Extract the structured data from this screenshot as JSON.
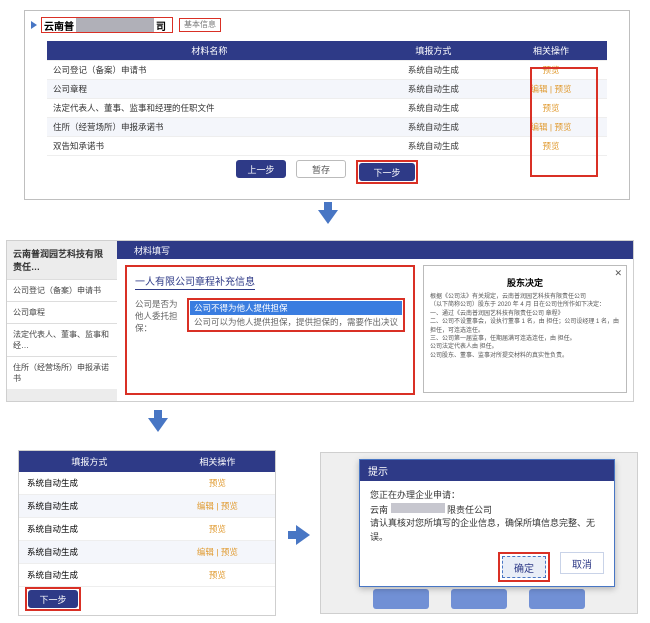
{
  "panel1": {
    "title_prefix": "云南普",
    "title_suffix": "司",
    "breadcrumb": "基本信息",
    "columns": {
      "name": "材料名称",
      "gen": "填报方式",
      "act": "相关操作"
    },
    "rows": [
      {
        "name": "公司登记（备案）申请书",
        "gen": "系统自动生成",
        "act": "预览"
      },
      {
        "name": "公司章程",
        "gen": "系统自动生成",
        "act": "编辑 | 预览"
      },
      {
        "name": "法定代表人、董事、监事和经理的任职文件",
        "gen": "系统自动生成",
        "act": "预览"
      },
      {
        "name": "住所（经营场所）申报承诺书",
        "gen": "系统自动生成",
        "act": "编辑 | 预览"
      },
      {
        "name": "双告知承诺书",
        "gen": "系统自动生成",
        "act": "预览"
      }
    ],
    "buttons": {
      "prev": "上一步",
      "save": "暂存",
      "next": "下一步"
    }
  },
  "panel2": {
    "side_title": "云南普润园艺科技有限责任…",
    "side_items": [
      "公司登记（备案）申请书",
      "公司章程",
      "法定代表人、董事、监事和经…",
      "住所（经营场所）申报承诺书"
    ],
    "tab": "材料填写",
    "form_title": "一人有限公司章程补充信息",
    "field_label": "公司是否为他人委托担保：",
    "option_selected": "公司不得为他人提供担保",
    "option_other": "公司可以为他人提供担保，提供担保的，需要作出决议",
    "doc_title": "股东决定",
    "doc_line1": "根据《公司法》有关规定，云南普润园艺科技有限责任公司",
    "doc_line2": "（以下简称公司）股东于 2020 年 4 月   日在公司住所作如下决定：",
    "doc_line3": "一、通过《云南普润园艺科技有限责任公司                章程》",
    "doc_line4": "二、公司不设董事会，设执行董事 1 名，由       担任；公司设经理 1 名，由       担任，可连选连任。",
    "doc_line5": "三、公司第一届监事，任期届满可连选连任，由         担任。",
    "doc_line6": "公司法定代表人由       担任。",
    "doc_line7": "公司股东、董事、监事对所提交材料的真实性负责。"
  },
  "panel3": {
    "columns": {
      "gen": "填报方式",
      "act": "相关操作"
    },
    "rows": [
      {
        "gen": "系统自动生成",
        "act": "预览"
      },
      {
        "gen": "系统自动生成",
        "act": "编辑 | 预览"
      },
      {
        "gen": "系统自动生成",
        "act": "预览"
      },
      {
        "gen": "系统自动生成",
        "act": "编辑 | 预览"
      },
      {
        "gen": "系统自动生成",
        "act": "预览"
      }
    ],
    "next": "下一步"
  },
  "panel4": {
    "title": "提示",
    "line1": "您正在办理企业申请：",
    "line2a": "云南",
    "line2b": "限责任公司",
    "line3": "请认真核对您所填写的企业信息，确保所填信息完整、无误。",
    "ok": "确定",
    "cancel": "取消"
  }
}
